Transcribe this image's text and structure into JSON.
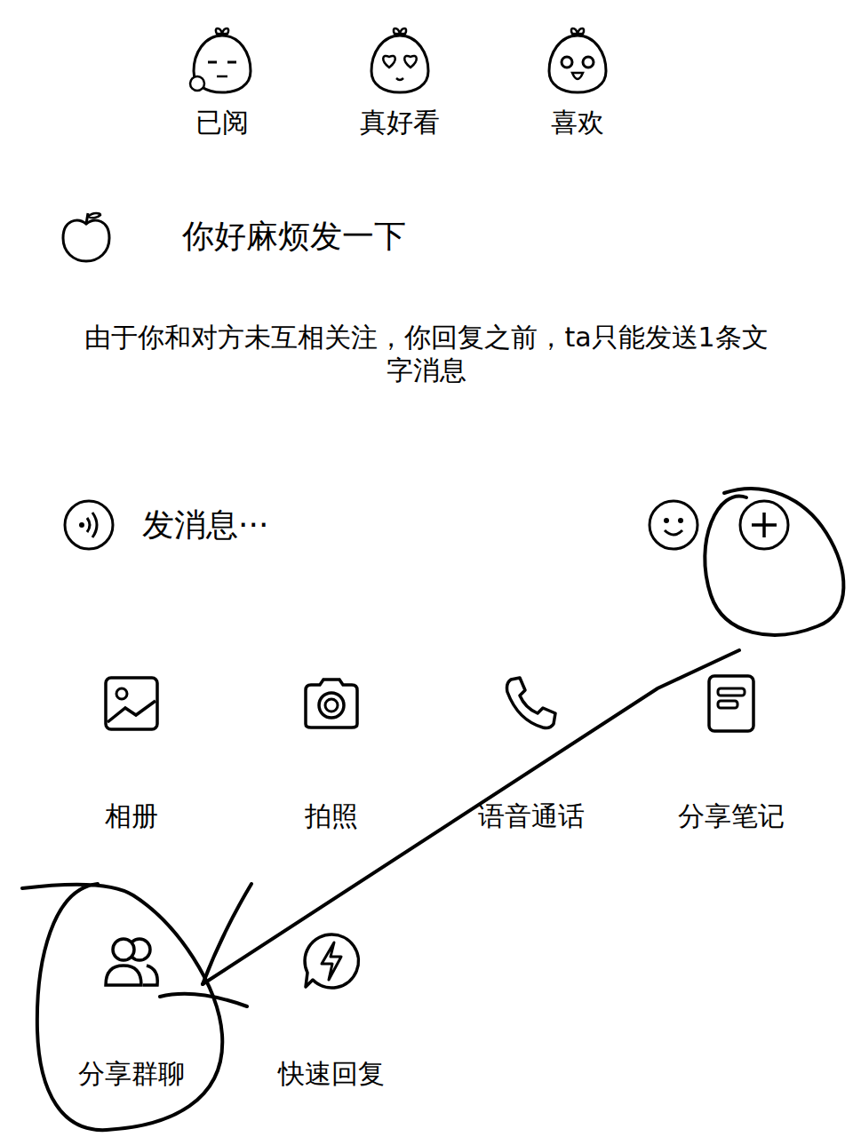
{
  "reactions": [
    {
      "label": "已阅"
    },
    {
      "label": "真好看"
    },
    {
      "label": "喜欢"
    }
  ],
  "message": {
    "text": "你好麻烦发一下"
  },
  "notice": "由于你和对方未互相关注，你回复之前，ta只能发送1条文字消息",
  "composer": {
    "placeholder": "发消息···"
  },
  "actions": [
    {
      "label": "相册"
    },
    {
      "label": "拍照"
    },
    {
      "label": "语音通话"
    },
    {
      "label": "分享笔记"
    },
    {
      "label": "分享群聊"
    },
    {
      "label": "快速回复"
    }
  ]
}
